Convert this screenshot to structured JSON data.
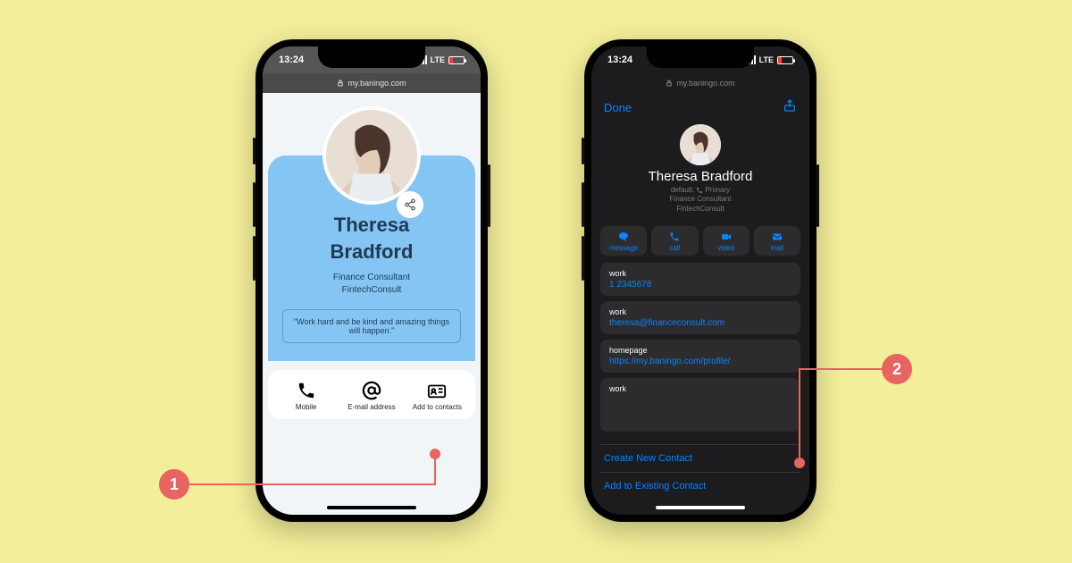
{
  "status": {
    "time": "13:24",
    "net": "LTE"
  },
  "url": "my.baningo.com",
  "phone1": {
    "name_first": "Theresa",
    "name_last": "Bradford",
    "role": "Finance Consultant",
    "company": "FintechConsult",
    "quote": "\"Work hard and be kind and amazing things will happen.\"",
    "actions": {
      "mobile": "Mobile",
      "email": "E-mail address",
      "add": "Add to contacts"
    }
  },
  "phone2": {
    "done": "Done",
    "name": "Theresa Bradford",
    "default_label": "default:",
    "primary": "Primary",
    "role": "Finance Consultant",
    "company": "FintechConsult",
    "pills": {
      "message": "message",
      "call": "call",
      "video": "video",
      "mail": "mail"
    },
    "fields": {
      "phone_lbl": "work",
      "phone_val": "1 2345678",
      "email_lbl": "work",
      "email_val": "theresa@financeconsult.com",
      "home_lbl": "homepage",
      "home_val": "https://my.baningo.com/profile/",
      "addr_lbl": "work"
    },
    "links": {
      "create": "Create New Contact",
      "add": "Add to Existing Contact"
    }
  },
  "anno": {
    "one": "1",
    "two": "2"
  }
}
